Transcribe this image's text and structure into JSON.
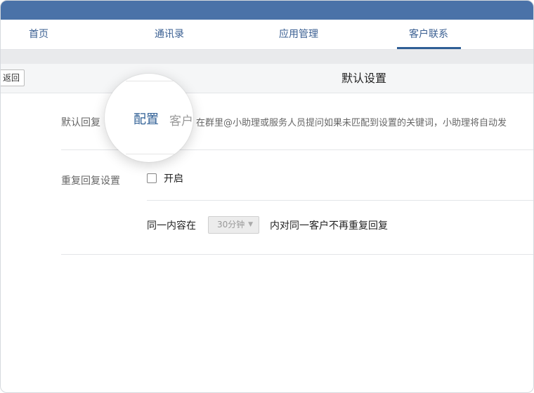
{
  "nav": {
    "tabs": [
      {
        "label": "首页"
      },
      {
        "label": "通讯录"
      },
      {
        "label": "应用管理"
      },
      {
        "label": "客户联系",
        "active": true
      }
    ]
  },
  "header": {
    "back_label": "返回",
    "title": "默认设置"
  },
  "default_reply": {
    "label": "默认回复",
    "description": "在群里@小助理或服务人员提问如果未匹配到设置的关键词，小助理将自动发"
  },
  "magnifier": {
    "active_tab": "配置",
    "inactive_tab": "客户"
  },
  "repeat_reply": {
    "label": "重复回复设置",
    "enable_label": "开启",
    "enabled": false,
    "prefix": "同一内容在",
    "interval_value": "30分钟",
    "suffix": "内对同一客户不再重复回复"
  },
  "colors": {
    "topbar": "#4a72a8",
    "accent": "#2f5f95"
  }
}
